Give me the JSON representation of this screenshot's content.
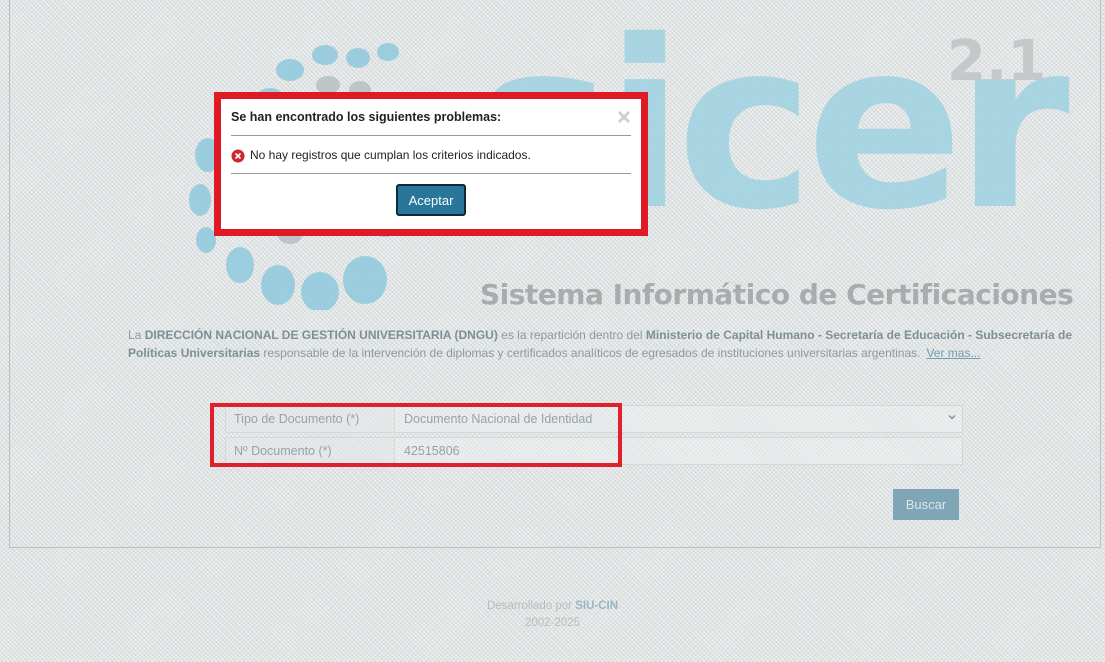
{
  "logo": {
    "word": "sicer",
    "version": "2.1",
    "subtitle": "Sistema Informático de Certificaciones"
  },
  "description": {
    "p1": "La ",
    "b1": "DIRECCIÓN NACIONAL DE GESTIÓN UNIVERSITARIA (DNGU)",
    "p2": " es la repartición dentro del ",
    "b2": "Ministerio de Capital Humano - Secretaría de Educación - Subsecretaría de Políticas Universitarias",
    "p3": " responsable de la intervención de diplomas y certificados analíticos de egresados de instituciones universitarias argentinas.",
    "link": "Ver mas..."
  },
  "form": {
    "tipo_label": "Tipo de Documento (*)",
    "tipo_value": "Documento Nacional de Identidad",
    "numero_label": "Nº Documento (*)",
    "numero_value": "42515806"
  },
  "buscar_label": "Buscar",
  "footer": {
    "prefix": "Desarrollado por ",
    "org": "SIU-CIN",
    "years": "2002-2025"
  },
  "modal": {
    "title": "Se han encontrado los siguientes problemas:",
    "message": "No hay registros que cumplan los criterios indicados.",
    "button": "Aceptar"
  },
  "colors": {
    "highlight": "#e01a24",
    "button": "#28779a",
    "logo_blue": "#9fd2e2"
  }
}
